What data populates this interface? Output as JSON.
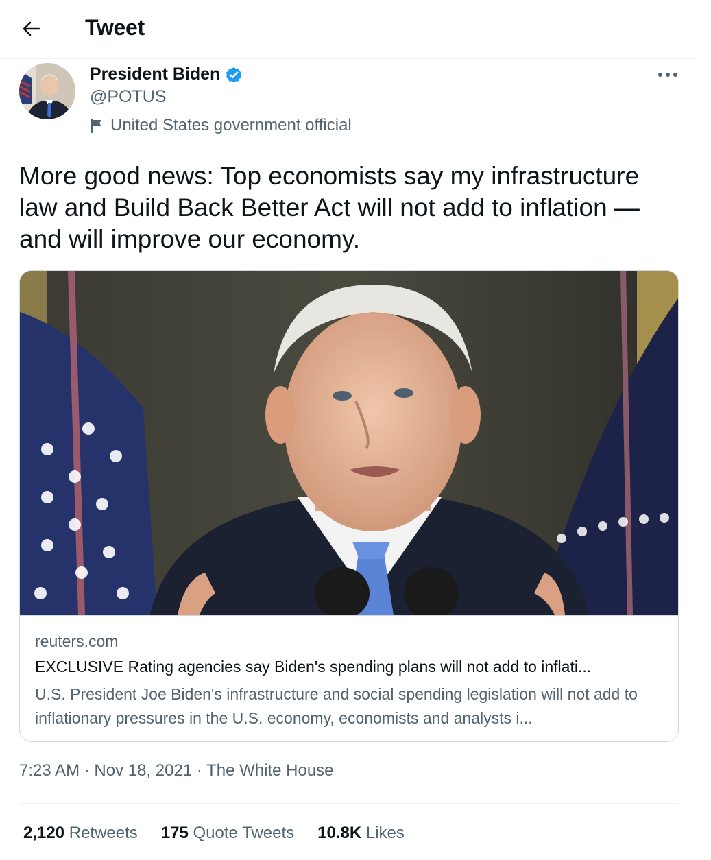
{
  "header": {
    "title": "Tweet"
  },
  "author": {
    "name": "President Biden",
    "handle": "@POTUS",
    "label": "United States government official"
  },
  "tweet": {
    "text": "More good news: Top economists say my infrastructure law and Build Back Better Act will not add to inflation — and will improve our economy."
  },
  "card": {
    "domain": "reuters.com",
    "title": "EXCLUSIVE Rating agencies say Biden's spending plans will not add to inflati...",
    "description": "U.S. President Joe Biden's infrastructure and social spending legislation will not add to inflationary pressures in the U.S. economy, economists and analysts i..."
  },
  "meta": {
    "time": "7:23 AM",
    "date": "Nov 18, 2021",
    "source": "The White House",
    "separator": "·"
  },
  "stats": {
    "retweets_count": "2,120",
    "retweets_label": "Retweets",
    "quotes_count": "175",
    "quotes_label": "Quote Tweets",
    "likes_count": "10.8K",
    "likes_label": "Likes"
  },
  "colors": {
    "text_primary": "#0f1419",
    "text_secondary": "#536471",
    "verified_blue": "#1d9bf0",
    "border": "#cfd9de"
  }
}
